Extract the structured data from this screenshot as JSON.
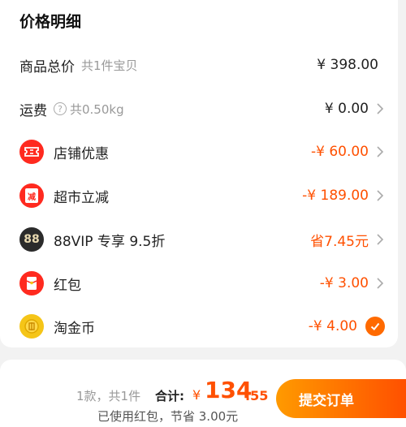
{
  "header": {
    "title": "价格明细"
  },
  "rows": {
    "goods": {
      "label": "商品总价",
      "sub": "共1件宝贝",
      "value": "¥ 398.00"
    },
    "shipping": {
      "label": "运费",
      "help": "?",
      "sub": "共0.50kg",
      "value": "¥ 0.00"
    },
    "shop_discount": {
      "label": "店铺优惠",
      "value": "-¥ 60.00",
      "icon": "ticket-icon"
    },
    "supermarket": {
      "label": "超市立减",
      "value": "-¥ 189.00",
      "icon": "red-envelope-minus-icon",
      "icon_glyph": "减"
    },
    "vip": {
      "label": "88VIP 专享 9.5折",
      "value": "省7.45元",
      "icon": "88vip-icon",
      "icon_glyph": "88"
    },
    "red_packet": {
      "label": "红包",
      "value": "-¥ 3.00",
      "icon": "red-packet-icon"
    },
    "gold_coin": {
      "label": "淘金币",
      "value": "-¥ 4.00",
      "icon": "gold-coin-icon",
      "checked": true
    }
  },
  "footer": {
    "count": "1款，共1件",
    "total_label": "合计:",
    "currency": "¥",
    "amount_int": "134",
    "amount_dec": ".55",
    "saved": "已使用红包，节省 3.00元",
    "submit_label": "提交订单"
  },
  "colors": {
    "accent": "#ff5000",
    "gold": "#f5c518",
    "vip_bg": "#2b2b2b"
  }
}
